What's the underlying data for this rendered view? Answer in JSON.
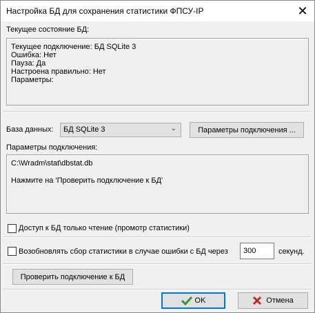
{
  "window": {
    "title": "Настройка БД для сохранения статистики ФПСУ-IP",
    "close_icon": "close-icon"
  },
  "status": {
    "label": "Текущее состояние БД:",
    "lines": [
      "Текущее подключение: БД SQLite 3",
      "Ошибка: Нет",
      "Пауза: Да",
      "Настроена правильно: Нет",
      "Параметры:"
    ]
  },
  "db": {
    "label": "База данных:",
    "selected": "БД SQLite 3",
    "params_button": "Параметры подключения ..."
  },
  "connection": {
    "label": "Параметры подключения:",
    "path": "C:\\Wradm\\stat\\dbstat.db",
    "hint": "Нажмите на 'Проверить подключение к БД'"
  },
  "options": {
    "readonly_label": "Доступ к БД только чтение (промотр статистики)",
    "readonly_checked": false,
    "resume_label": "Возобновлять сбор статистики  в случае ошибки с БД через",
    "resume_checked": false,
    "resume_seconds": "300",
    "resume_unit": "секунд."
  },
  "actions": {
    "check_button": "Проверить подключение к БД",
    "ok_button": "OK",
    "cancel_button": "Отмена",
    "ok_color": "#2e9a2e",
    "cancel_color": "#c0282d"
  }
}
